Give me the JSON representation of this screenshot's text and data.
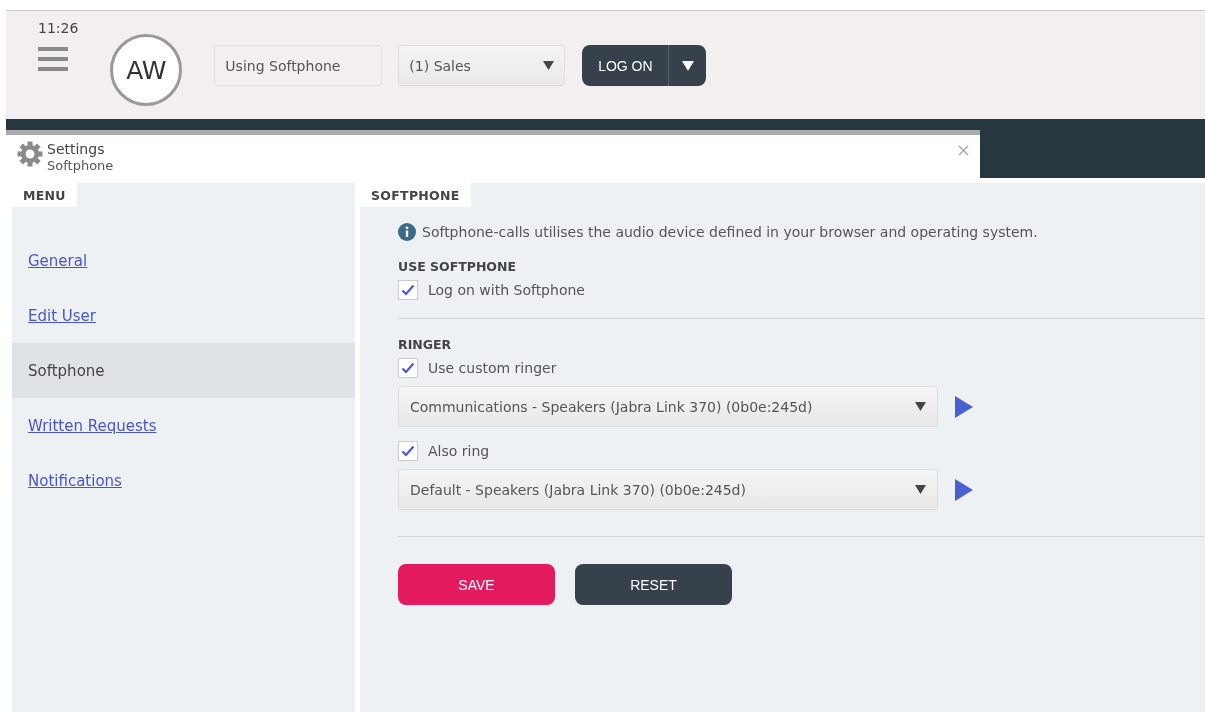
{
  "header": {
    "time": "11:26",
    "avatar": "AW",
    "status_field": {
      "value": "Using Softphone"
    },
    "queue_select": {
      "value": "(1) Sales"
    },
    "logon_button": {
      "label": "LOG ON"
    }
  },
  "settings": {
    "title": "Settings",
    "subtitle": "Softphone"
  },
  "menu": {
    "label": "MENU",
    "items": [
      {
        "label": "General",
        "selected": false
      },
      {
        "label": "Edit User",
        "selected": false
      },
      {
        "label": "Softphone",
        "selected": true
      },
      {
        "label": "Written Requests",
        "selected": false
      },
      {
        "label": "Notifications",
        "selected": false
      }
    ]
  },
  "content": {
    "label": "SOFTPHONE",
    "info": "Softphone-calls utilises the audio device defined in your browser and operating system.",
    "sections": [
      {
        "heading": "USE SOFTPHONE",
        "items": [
          {
            "kind": "checkbox",
            "label": "Log on with Softphone",
            "checked": true
          }
        ]
      },
      {
        "heading": "RINGER",
        "items": [
          {
            "kind": "checkbox",
            "label": "Use custom ringer",
            "checked": true
          },
          {
            "kind": "select",
            "value": "Communications - Speakers (Jabra Link 370) (0b0e:245d)"
          },
          {
            "kind": "checkbox",
            "label": "Also ring",
            "checked": true
          },
          {
            "kind": "select",
            "value": "Default - Speakers (Jabra Link 370) (0b0e:245d)"
          }
        ]
      }
    ],
    "buttons": [
      {
        "kind": "primary",
        "label": "SAVE"
      },
      {
        "kind": "secondary",
        "label": "RESET"
      }
    ]
  }
}
